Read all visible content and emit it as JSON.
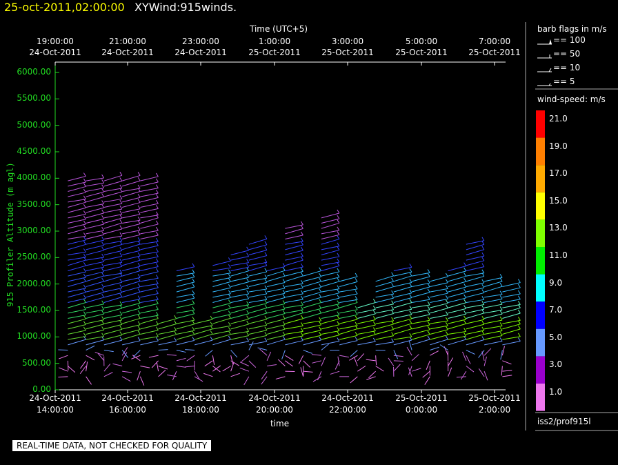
{
  "header": {
    "date": "25-oct-2011,02:00:00",
    "name": "XYWind:915winds."
  },
  "top_axis": {
    "title": "Time (UTC+5)",
    "ticks": [
      {
        "time": "19:00:00",
        "date": "24-Oct-2011"
      },
      {
        "time": "21:00:00",
        "date": "24-Oct-2011"
      },
      {
        "time": "23:00:00",
        "date": "24-Oct-2011"
      },
      {
        "time": "1:00:00",
        "date": "25-Oct-2011"
      },
      {
        "time": "3:00:00",
        "date": "25-Oct-2011"
      },
      {
        "time": "5:00:00",
        "date": "25-Oct-2011"
      },
      {
        "time": "7:00:00",
        "date": "25-Oct-2011"
      }
    ]
  },
  "legend": {
    "barb_title": "barb flags in m/s",
    "barb_items": [
      "== 100",
      "== 50",
      "== 10",
      "== 5"
    ],
    "speed_title": "wind-speed: m/s",
    "speed_scale": [
      {
        "label": "21.0",
        "color": "#ff0000"
      },
      {
        "label": "19.0",
        "color": "#ff7f00"
      },
      {
        "label": "17.0",
        "color": "#ffaa00"
      },
      {
        "label": "15.0",
        "color": "#ffff00"
      },
      {
        "label": "13.0",
        "color": "#7fff00"
      },
      {
        "label": "11.0",
        "color": "#00ee00"
      },
      {
        "label": "9.0",
        "color": "#00ffff"
      },
      {
        "label": "7.0",
        "color": "#0000ff"
      },
      {
        "label": "5.0",
        "color": "#6699ff"
      },
      {
        "label": "3.0",
        "color": "#9900cc"
      },
      {
        "label": "1.0",
        "color": "#ee77ee"
      }
    ],
    "source": "iss2/prof915l"
  },
  "quality_note": "REAL-TIME DATA, NOT CHECKED FOR QUALITY",
  "chart_data": {
    "type": "scatter",
    "xlabel": "time",
    "ylabel": "915 Profiler Altitude (m agl)",
    "ylim": [
      0,
      6000
    ],
    "y_ticks": [
      "6000.00",
      "5500.00",
      "5000.00",
      "4500.00",
      "4000.00",
      "3500.00",
      "3000.00",
      "2500.00",
      "2000.00",
      "1500.00",
      "1000.00",
      "500.00",
      "0.00"
    ],
    "x_ticks": [
      {
        "date": "24-Oct-2011",
        "time": "14:00:00"
      },
      {
        "date": "24-Oct-2011",
        "time": "16:00:00"
      },
      {
        "date": "24-Oct-2011",
        "time": "18:00:00"
      },
      {
        "date": "24-Oct-2011",
        "time": "20:00:00"
      },
      {
        "date": "24-Oct-2011",
        "time": "22:00:00"
      },
      {
        "date": "25-Oct-2011",
        "time": "0:00:00"
      },
      {
        "date": "25-Oct-2011",
        "time": "2:00:00"
      }
    ],
    "xlim_hours": [
      0,
      12.5
    ],
    "profiles": [
      {
        "t": 0.35,
        "top": 4000
      },
      {
        "t": 0.85,
        "top": 3950
      },
      {
        "t": 1.35,
        "top": 3950
      },
      {
        "t": 1.85,
        "top": 4000
      },
      {
        "t": 2.35,
        "top": 4000
      },
      {
        "t": 2.85,
        "top": 1300
      },
      {
        "t": 3.35,
        "top": 2300
      },
      {
        "t": 3.85,
        "top": 1300
      },
      {
        "t": 4.35,
        "top": 2400
      },
      {
        "t": 4.85,
        "top": 2600
      },
      {
        "t": 5.35,
        "top": 2800
      },
      {
        "t": 5.85,
        "top": 2300
      },
      {
        "t": 6.35,
        "top": 3100
      },
      {
        "t": 6.85,
        "top": 2200
      },
      {
        "t": 7.35,
        "top": 3300
      },
      {
        "t": 7.85,
        "top": 2100
      },
      {
        "t": 8.35,
        "top": 1600
      },
      {
        "t": 8.85,
        "top": 2100
      },
      {
        "t": 9.35,
        "top": 2300
      },
      {
        "t": 9.85,
        "top": 2200
      },
      {
        "t": 10.35,
        "top": 2100
      },
      {
        "t": 10.85,
        "top": 2300
      },
      {
        "t": 11.35,
        "top": 2800
      },
      {
        "t": 11.85,
        "top": 2100
      },
      {
        "t": 12.35,
        "top": 2000
      }
    ]
  }
}
